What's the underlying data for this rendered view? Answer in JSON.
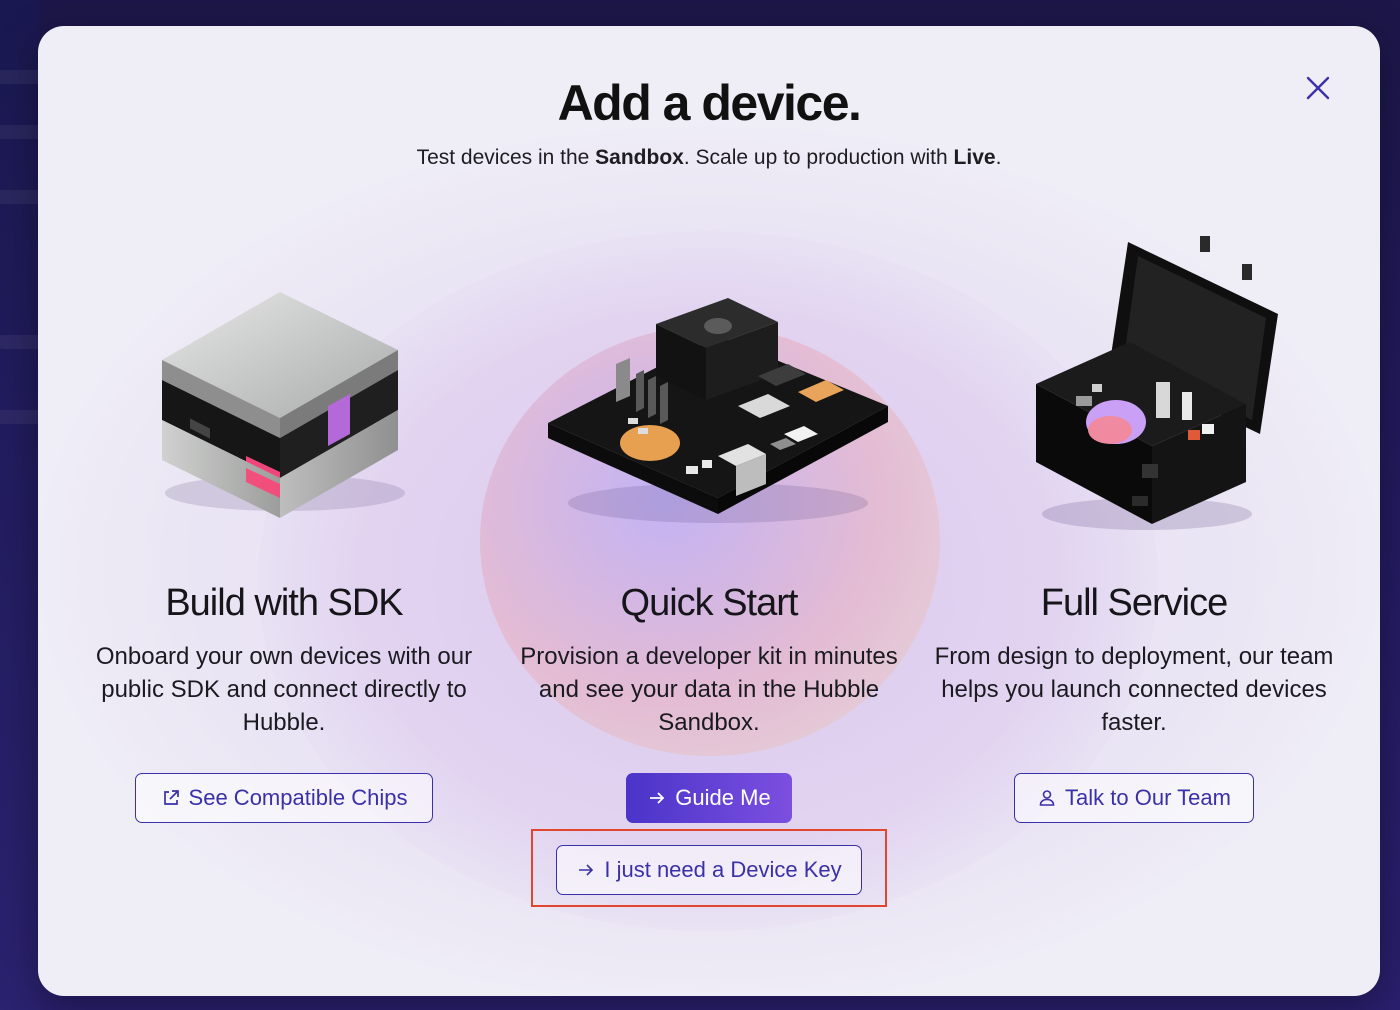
{
  "modal": {
    "title": "Add a device.",
    "subtitle_pre": "Test devices in the ",
    "subtitle_sandbox": "Sandbox",
    "subtitle_mid": ". Scale up to production with ",
    "subtitle_live": "Live",
    "subtitle_end": "."
  },
  "options": [
    {
      "title": "Build with SDK",
      "description": "Onboard your own devices with our public SDK and connect directly to Hubble.",
      "button_label": "See Compatible Chips",
      "button_icon": "external-link-icon"
    },
    {
      "title": "Quick Start",
      "description": "Provision a developer kit in minutes and see your data in the Hubble Sandbox.",
      "button_label": "Guide Me",
      "button_icon": "arrow-right-icon",
      "secondary_button_label": "I just need a Device Key",
      "secondary_button_icon": "arrow-right-icon"
    },
    {
      "title": "Full Service",
      "description": "From design to deployment, our team helps you launch connected devices faster.",
      "button_label": "Talk to Our Team",
      "button_icon": "user-icon"
    }
  ],
  "colors": {
    "accent": "#3a31a8",
    "primary_gradient_start": "#4a34c9",
    "primary_gradient_end": "#7c4fe0",
    "highlight": "#e0472e"
  }
}
